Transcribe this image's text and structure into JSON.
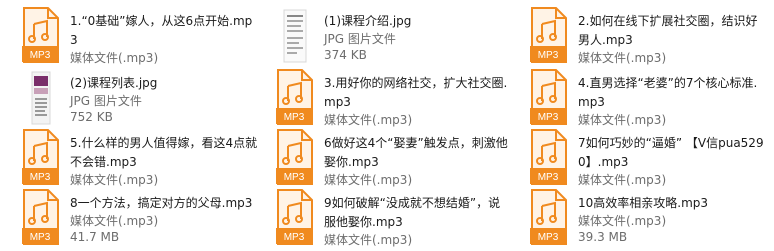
{
  "files": [
    {
      "name": "1.“0基础”嫁人，从这6点开始.mp3",
      "type_label": "媒体文件(.mp3)",
      "size": "",
      "icon": "mp3-file-icon",
      "icon_label": "MP3"
    },
    {
      "name": "(1)课程介绍.jpg",
      "type_label": "JPG 图片文件",
      "size": "374 KB",
      "icon": "jpg-thumbnail-document",
      "icon_label": ""
    },
    {
      "name": "2.如何在线下扩展社交圈，结识好男人.mp3",
      "type_label": "媒体文件(.mp3)",
      "size": "",
      "icon": "mp3-file-icon",
      "icon_label": "MP3"
    },
    {
      "name": "(2)课程列表.jpg",
      "type_label": "JPG 图片文件",
      "size": "752 KB",
      "icon": "jpg-thumbnail-cover",
      "icon_label": ""
    },
    {
      "name": "3.用好你的网络社交，扩大社交圈.mp3",
      "type_label": "媒体文件(.mp3)",
      "size": "",
      "icon": "mp3-file-icon",
      "icon_label": "MP3"
    },
    {
      "name": "4.直男选择“老婆”的7个核心标准.mp3",
      "type_label": "媒体文件(.mp3)",
      "size": "",
      "icon": "mp3-file-icon",
      "icon_label": "MP3"
    },
    {
      "name": "5.什么样的男人值得嫁，看这4点就不会错.mp3",
      "type_label": "媒体文件(.mp3)",
      "size": "",
      "icon": "mp3-file-icon",
      "icon_label": "MP3"
    },
    {
      "name": "6做好这4个“娶妻”触发点，刺激他娶你.mp3",
      "type_label": "媒体文件(.mp3)",
      "size": "",
      "icon": "mp3-file-icon",
      "icon_label": "MP3"
    },
    {
      "name": "7如何巧妙的“逼婚” 【V信pua5290】.mp3",
      "type_label": "媒体文件(.mp3)",
      "size": "",
      "icon": "mp3-file-icon",
      "icon_label": "MP3"
    },
    {
      "name": "8一个方法，搞定对方的父母.mp3",
      "type_label": "媒体文件(.mp3)",
      "size": "41.7 MB",
      "icon": "mp3-file-icon",
      "icon_label": "MP3"
    },
    {
      "name": "9如何破解“没成就不想结婚”，说服他娶你.mp3",
      "type_label": "媒体文件(.mp3)",
      "size": "",
      "icon": "mp3-file-icon",
      "icon_label": "MP3"
    },
    {
      "name": "10高效率相亲攻略.mp3",
      "type_label": "媒体文件(.mp3)",
      "size": "39.3 MB",
      "icon": "mp3-file-icon",
      "icon_label": "MP3"
    }
  ],
  "colors": {
    "mp3_icon_orange": "#f08a1f",
    "mp3_icon_light": "#fff3e6",
    "text": "#1a1a1a",
    "meta": "#6d6d6d",
    "cover_purple": "#7a2e6a"
  }
}
